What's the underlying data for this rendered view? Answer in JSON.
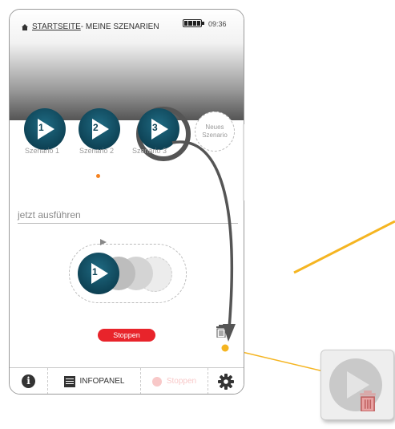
{
  "header": {
    "breadcrumb_start": "STARTSEITE",
    "breadcrumb_rest": " - MEINE SZENARIEN",
    "time": "09:36"
  },
  "scenarios": [
    {
      "number": "1",
      "label": "Szenario 1"
    },
    {
      "number": "2",
      "label": "Szenario 2"
    },
    {
      "number": "3",
      "label": "Szenario 3"
    }
  ],
  "new_scenario": {
    "line1": "Neues",
    "line2": "Szenario"
  },
  "execute": {
    "label": "jetzt ausführen"
  },
  "queue": {
    "first_number": "1"
  },
  "stop_button": {
    "label": "Stoppen"
  },
  "bottom_bar": {
    "info_icon": "i",
    "infopanel_label": "INFOPANEL",
    "stop_label": "Stoppen"
  },
  "colors": {
    "scenario_teal": "#0e4356",
    "accent_orange": "#f58220",
    "stop_red": "#e8242b",
    "annotation_yellow": "#f5b521"
  }
}
